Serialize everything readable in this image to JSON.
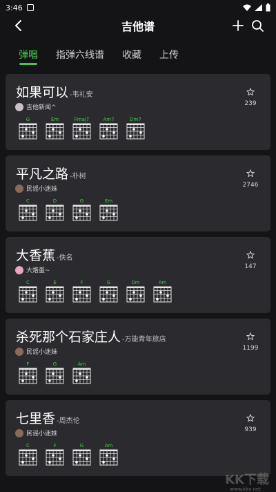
{
  "status": {
    "time": "3:46"
  },
  "header": {
    "title": "吉他谱"
  },
  "tabs": [
    "弹唱",
    "指弹六线谱",
    "收藏",
    "上传"
  ],
  "songs": [
    {
      "title": "如果可以",
      "artist": "韦礼安",
      "uploader": "吉他新闻^",
      "avatar": "white",
      "favorites": "239",
      "chords": [
        "G",
        "Em",
        "Fmaj7",
        "Am7",
        "Dm7"
      ]
    },
    {
      "title": "平凡之路",
      "artist": "朴树",
      "uploader": "民谣小迷妹",
      "avatar": "guitar",
      "favorites": "2746",
      "chords": [
        "C",
        "D",
        "G",
        "Em"
      ]
    },
    {
      "title": "大香蕉",
      "artist": "佚名",
      "uploader": "大烙蛋~",
      "avatar": "pink",
      "favorites": "147",
      "chords": [
        "C",
        "E",
        "F",
        "G",
        "Dm",
        "Am"
      ]
    },
    {
      "title": "杀死那个石家庄人",
      "artist": "万能青年旅店",
      "uploader": "民谣小迷妹",
      "avatar": "guitar",
      "favorites": "1199",
      "chords": [
        "F",
        "G",
        "Am"
      ]
    },
    {
      "title": "七里香",
      "artist": "周杰伦",
      "uploader": "民谣小迷妹",
      "avatar": "guitar",
      "favorites": "939",
      "chords": [
        "C",
        "F",
        "G",
        "Am"
      ]
    }
  ],
  "watermark": {
    "text": "KK下载",
    "url": "www.kkx.net"
  },
  "colors": {
    "accent": "#45c84a",
    "background": "#141416",
    "card": "#2b2b2f"
  }
}
